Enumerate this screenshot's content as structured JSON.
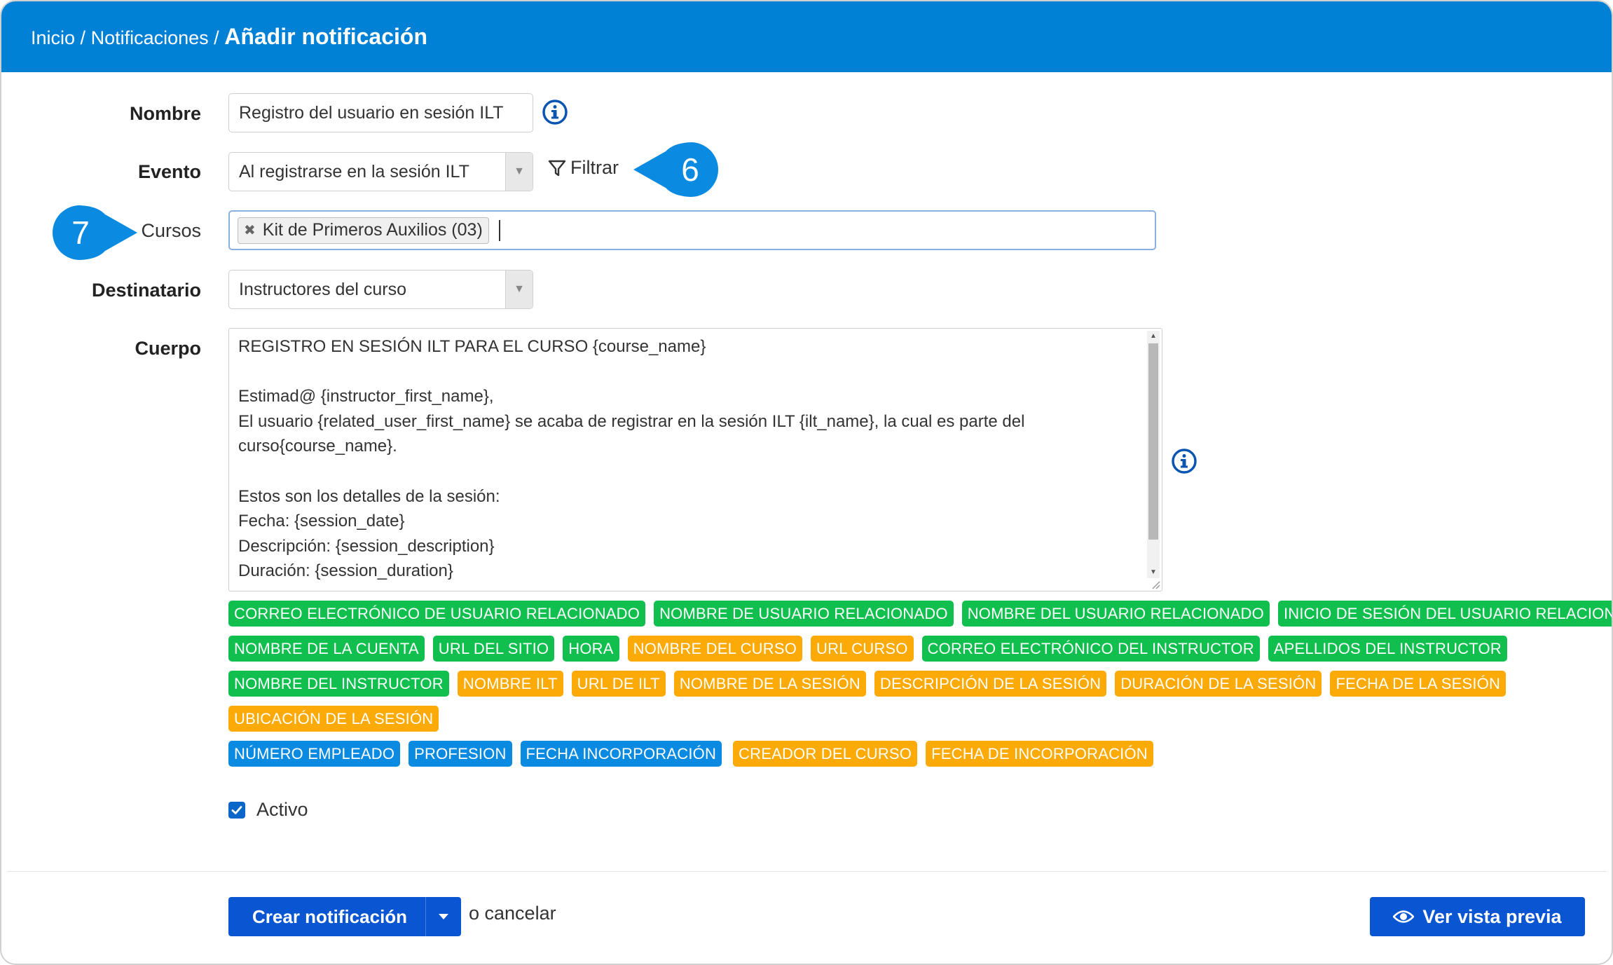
{
  "breadcrumb": {
    "home": "Inicio",
    "sep": "/",
    "section": "Notificaciones",
    "current": "Añadir notificación"
  },
  "form": {
    "nombre": {
      "label": "Nombre",
      "value": "Registro del usuario en sesión ILT"
    },
    "evento": {
      "label": "Evento",
      "value": "Al registrarse en la sesión ILT",
      "filter_label": "Filtrar"
    },
    "cursos": {
      "label": "Cursos",
      "selected_tag": "Kit de Primeros Auxilios (03)"
    },
    "destinatario": {
      "label": "Destinatario",
      "value": "Instructores del curso"
    },
    "cuerpo": {
      "label": "Cuerpo",
      "text": "REGISTRO EN SESIÓN ILT PARA EL CURSO {course_name}\n\nEstimad@ {instructor_first_name},\nEl usuario {related_user_first_name} se acaba de registrar en la sesión ILT {ilt_name}, la cual es parte del\ncurso{course_name}.\n\nEstos son los detalles de la sesión:\nFecha: {session_date}\nDescripción: {session_description}\nDuración: {session_duration}"
    },
    "activo": {
      "label": "Activo",
      "checked": true
    }
  },
  "callouts": {
    "six": "6",
    "seven": "7"
  },
  "colors": {
    "header": "#0081d6",
    "green": "#11bf4e",
    "orange": "#fcaa07",
    "blue": "#0a8ae0",
    "primary_button": "#0a55d1",
    "callout": "#0a8ae0"
  },
  "placeholder_rows": [
    [
      {
        "text": "CORREO ELECTRÓNICO DE USUARIO RELACIONADO",
        "color": "green"
      },
      {
        "text": "NOMBRE DE USUARIO RELACIONADO",
        "color": "green"
      },
      {
        "text": "NOMBRE DEL USUARIO RELACIONADO",
        "color": "green"
      },
      {
        "text": "INICIO DE SESIÓN DEL USUARIO RELACIONADO",
        "color": "green"
      }
    ],
    [
      {
        "text": "NOMBRE DE LA CUENTA",
        "color": "green"
      },
      {
        "text": "URL DEL SITIO",
        "color": "green"
      },
      {
        "text": "HORA",
        "color": "green"
      },
      {
        "text": "NOMBRE DEL CURSO",
        "color": "orange"
      },
      {
        "text": "URL CURSO",
        "color": "orange"
      },
      {
        "text": "CORREO ELECTRÓNICO DEL INSTRUCTOR",
        "color": "green"
      },
      {
        "text": "APELLIDOS DEL INSTRUCTOR",
        "color": "green"
      }
    ],
    [
      {
        "text": "NOMBRE DEL INSTRUCTOR",
        "color": "green"
      },
      {
        "text": "NOMBRE ILT",
        "color": "orange"
      },
      {
        "text": "URL DE ILT",
        "color": "orange"
      },
      {
        "text": "NOMBRE DE LA SESIÓN",
        "color": "orange"
      },
      {
        "text": "DESCRIPCIÓN DE LA SESIÓN",
        "color": "orange"
      },
      {
        "text": "DURACIÓN DE LA SESIÓN",
        "color": "orange"
      },
      {
        "text": "FECHA DE LA SESIÓN",
        "color": "orange"
      }
    ],
    [
      {
        "text": "UBICACIÓN DE LA SESIÓN",
        "color": "orange"
      }
    ],
    [
      {
        "text": "NÚMERO EMPLEADO",
        "color": "blue"
      },
      {
        "text": "PROFESION",
        "color": "blue"
      },
      {
        "text": "FECHA INCORPORACIÓN",
        "color": "blue"
      },
      {
        "text": "CREADOR DEL CURSO",
        "color": "orange",
        "gap_before": true
      },
      {
        "text": "FECHA DE INCORPORACIÓN",
        "color": "orange"
      }
    ]
  ],
  "footer": {
    "create_button": "Crear notificación",
    "cancel_text": "o cancelar",
    "preview_button": "Ver vista previa"
  }
}
